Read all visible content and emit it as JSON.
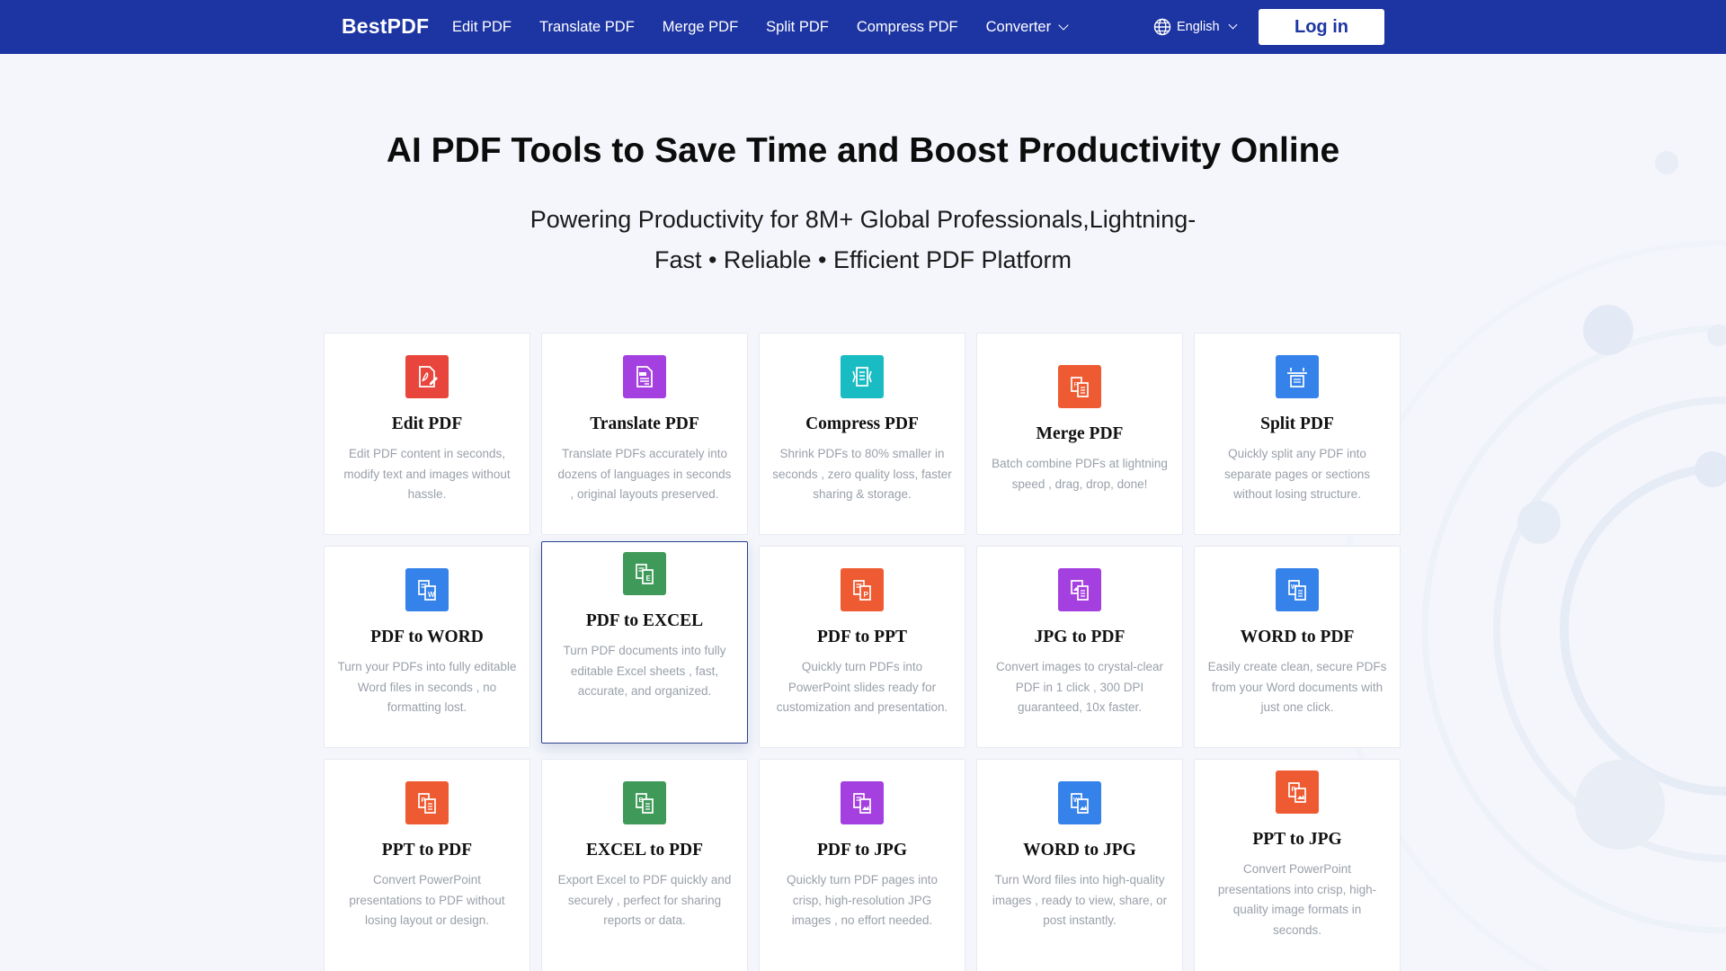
{
  "header": {
    "brand": "BestPDF",
    "nav": [
      {
        "label": "Edit PDF"
      },
      {
        "label": "Translate PDF"
      },
      {
        "label": "Merge PDF"
      },
      {
        "label": "Split PDF"
      },
      {
        "label": "Compress PDF"
      },
      {
        "label": "Converter",
        "has_dropdown": true
      }
    ],
    "language": "English",
    "login_label": "Log in"
  },
  "hero": {
    "title": "AI PDF Tools to Save Time and Boost Productivity Online",
    "subtitle_line1": "Powering Productivity for 8M+ Global Professionals,Lightning-",
    "subtitle_line2": "Fast • Reliable • Efficient PDF Platform"
  },
  "colors": {
    "header_bg": "#1d35a3",
    "page_bg": "#f4f6fb",
    "red": "#e8453c",
    "purple": "#a43fe0",
    "teal": "#19bcc3",
    "orange": "#ee5a32",
    "blue": "#3582ea",
    "green": "#3f9a5a"
  },
  "tools": [
    {
      "title": "Edit PDF",
      "desc": "Edit PDF content in seconds, modify text and images without hassle.",
      "icon": "edit-pdf-icon",
      "color": "#e8453c"
    },
    {
      "title": "Translate PDF",
      "desc": "Translate PDFs accurately into dozens of languages in seconds , original layouts preserved.",
      "icon": "translate-pdf-icon",
      "color": "#a43fe0"
    },
    {
      "title": "Compress PDF",
      "desc": "Shrink PDFs to 80% smaller in seconds , zero quality loss, faster sharing & storage.",
      "icon": "compress-pdf-icon",
      "color": "#19bcc3"
    },
    {
      "title": "Merge PDF",
      "desc": "Batch combine PDFs at lightning speed , drag, drop, done!",
      "icon": "merge-pdf-icon",
      "color": "#ee5a32"
    },
    {
      "title": "Split PDF",
      "desc": "Quickly split any PDF into separate pages or sections without losing structure.",
      "icon": "split-pdf-icon",
      "color": "#3582ea"
    },
    {
      "title": "PDF to WORD",
      "desc": "Turn your PDFs into fully editable Word files in seconds , no formatting lost.",
      "icon": "pdf-to-word-icon",
      "color": "#3582ea"
    },
    {
      "title": "PDF to EXCEL",
      "desc": "Turn PDF documents into fully editable Excel sheets , fast, accurate, and organized.",
      "icon": "pdf-to-excel-icon",
      "color": "#3f9a5a"
    },
    {
      "title": "PDF to PPT",
      "desc": "Quickly turn PDFs into PowerPoint slides ready for customization and presentation.",
      "icon": "pdf-to-ppt-icon",
      "color": "#ee5a32"
    },
    {
      "title": "JPG to PDF",
      "desc": "Convert images to crystal-clear PDF in 1 click , 300 DPI guaranteed, 10x faster.",
      "icon": "jpg-to-pdf-icon",
      "color": "#a43fe0"
    },
    {
      "title": "WORD to PDF",
      "desc": "Easily create clean, secure PDFs from your Word documents with just one click.",
      "icon": "word-to-pdf-icon",
      "color": "#3582ea"
    },
    {
      "title": "PPT to PDF",
      "desc": "Convert PowerPoint presentations to PDF without losing layout or design.",
      "icon": "ppt-to-pdf-icon",
      "color": "#ee5a32"
    },
    {
      "title": "EXCEL to PDF",
      "desc": "Export Excel to PDF quickly and securely , perfect for sharing reports or data.",
      "icon": "excel-to-pdf-icon",
      "color": "#3f9a5a"
    },
    {
      "title": "PDF to JPG",
      "desc": "Quickly turn PDF pages into crisp, high-resolution JPG images , no effort needed.",
      "icon": "pdf-to-jpg-icon",
      "color": "#a43fe0"
    },
    {
      "title": "WORD to JPG",
      "desc": "Turn Word files into high-quality images , ready to view, share, or post instantly.",
      "icon": "word-to-jpg-icon",
      "color": "#3582ea"
    },
    {
      "title": "PPT to JPG",
      "desc": "Convert PowerPoint presentations into crisp, high-quality image formats in seconds.",
      "icon": "ppt-to-jpg-icon",
      "color": "#ee5a32"
    }
  ]
}
